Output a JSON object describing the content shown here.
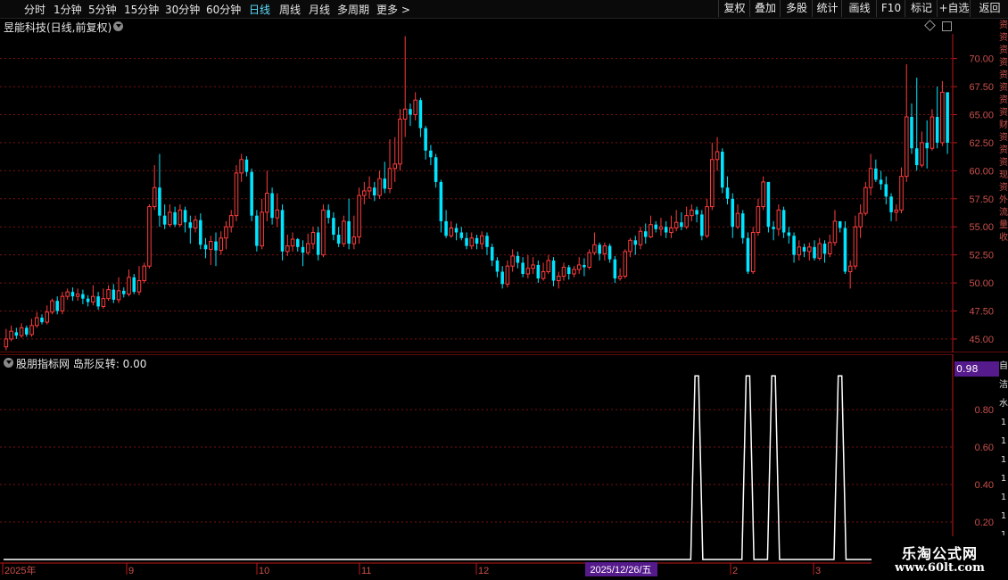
{
  "toolbar": {
    "left_items": [
      {
        "label": "分时",
        "active": false
      },
      {
        "label": "1分钟",
        "active": false
      },
      {
        "label": "5分钟",
        "active": false
      },
      {
        "label": "15分钟",
        "active": false
      },
      {
        "label": "30分钟",
        "active": false
      },
      {
        "label": "60分钟",
        "active": false
      },
      {
        "label": "日线",
        "active": true
      },
      {
        "label": "周线",
        "active": false
      },
      {
        "label": "月线",
        "active": false
      },
      {
        "label": "多周期",
        "active": false
      },
      {
        "label": "更多 >",
        "active": false
      }
    ],
    "right_items": [
      "复权",
      "叠加",
      "多股",
      "统计",
      "画线",
      "F10",
      "标记",
      "+自选",
      "返回"
    ]
  },
  "stock": {
    "title": "昱能科技(日线,前复权)"
  },
  "main_axis": {
    "ticks": [
      "70.00",
      "67.50",
      "65.00",
      "62.50",
      "60.00",
      "57.50",
      "55.00",
      "52.50",
      "50.00",
      "47.50",
      "45.00"
    ]
  },
  "indicator": {
    "title": "股朋指标网 岛形反转: 0.00",
    "badge": "0.98",
    "ticks": [
      "0.80",
      "0.60",
      "0.40",
      "0.20"
    ]
  },
  "time_axis": {
    "labels": [
      "2025年",
      "9",
      "10",
      "11",
      "12",
      "2",
      "3"
    ],
    "cursor": "2025/12/26/五"
  },
  "right_strip": {
    "top_chars": [
      "资",
      "资",
      "资",
      "资",
      "资",
      "资",
      "资",
      "资",
      "财",
      "资",
      "资",
      "资",
      "现",
      "资",
      "外",
      "流",
      "量",
      "收"
    ],
    "bottom_chars": [
      "自",
      "洁",
      "水",
      "1",
      "1",
      "1",
      "1",
      "1",
      "1",
      "1"
    ]
  },
  "watermark": {
    "line1": "乐淘公式网",
    "line2": "www.60lt.com"
  },
  "colors": {
    "up": "#ff3c3c",
    "down": "#00e5ff",
    "grid": "#7a1010",
    "axis": "#c01818",
    "signal": "#ffffff"
  },
  "chart_data": {
    "type": "candlestick",
    "ylim": [
      43.8,
      72.2
    ],
    "candles": [
      [
        44.3,
        45.0,
        44.0,
        45.9
      ],
      [
        45.0,
        45.7,
        44.8,
        46.2
      ],
      [
        45.6,
        45.3,
        45.0,
        46.0
      ],
      [
        45.3,
        46.0,
        45.1,
        46.4
      ],
      [
        46.0,
        45.4,
        45.2,
        46.2
      ],
      [
        45.4,
        46.2,
        45.2,
        46.8
      ],
      [
        46.2,
        46.9,
        46.0,
        47.4
      ],
      [
        46.9,
        46.5,
        46.3,
        47.2
      ],
      [
        46.5,
        47.4,
        46.3,
        48.0
      ],
      [
        47.4,
        48.4,
        47.2,
        48.6
      ],
      [
        48.4,
        47.5,
        47.2,
        48.8
      ],
      [
        47.5,
        48.8,
        47.2,
        49.2
      ],
      [
        48.8,
        49.2,
        48.5,
        49.5
      ],
      [
        49.2,
        48.8,
        48.4,
        49.6
      ],
      [
        48.8,
        49.0,
        48.4,
        49.5
      ],
      [
        49.0,
        48.6,
        48.1,
        49.4
      ],
      [
        48.6,
        48.3,
        47.9,
        48.9
      ],
      [
        48.3,
        48.8,
        48.0,
        49.8
      ],
      [
        48.8,
        47.9,
        47.6,
        49.2
      ],
      [
        47.9,
        48.6,
        47.7,
        49.5
      ],
      [
        48.6,
        49.4,
        48.4,
        49.8
      ],
      [
        49.4,
        48.5,
        48.2,
        49.9
      ],
      [
        48.5,
        49.3,
        48.2,
        50.5
      ],
      [
        49.3,
        49.0,
        48.7,
        49.6
      ],
      [
        49.0,
        50.5,
        48.8,
        51.2
      ],
      [
        50.5,
        49.2,
        49.0,
        50.8
      ],
      [
        49.2,
        50.2,
        48.9,
        51.5
      ],
      [
        50.2,
        51.5,
        50.0,
        51.8
      ],
      [
        51.5,
        56.8,
        51.3,
        57.0
      ],
      [
        56.8,
        58.5,
        56.5,
        60.5
      ],
      [
        58.5,
        56.0,
        55.0,
        61.5
      ],
      [
        56.0,
        55.2,
        54.8,
        57.0
      ],
      [
        55.2,
        56.3,
        55.0,
        57.0
      ],
      [
        56.3,
        55.2,
        55.0,
        56.8
      ],
      [
        55.2,
        56.5,
        55.0,
        57.0
      ],
      [
        56.5,
        55.4,
        54.5,
        56.8
      ],
      [
        55.4,
        54.9,
        53.5,
        56.0
      ],
      [
        54.9,
        55.6,
        54.5,
        56.0
      ],
      [
        55.6,
        53.4,
        53.0,
        56.2
      ],
      [
        53.4,
        53.0,
        52.2,
        54.0
      ],
      [
        53.0,
        53.7,
        51.6,
        54.2
      ],
      [
        53.7,
        52.9,
        51.5,
        54.5
      ],
      [
        52.9,
        54.0,
        52.5,
        54.6
      ],
      [
        54.0,
        55.0,
        53.0,
        55.5
      ],
      [
        55.0,
        56.0,
        54.5,
        56.5
      ],
      [
        56.0,
        59.8,
        55.5,
        60.5
      ],
      [
        59.8,
        61.0,
        59.0,
        61.5
      ],
      [
        61.0,
        59.9,
        59.5,
        61.3
      ],
      [
        59.9,
        56.0,
        55.5,
        60.2
      ],
      [
        56.0,
        53.3,
        52.8,
        56.5
      ],
      [
        53.3,
        56.3,
        53.0,
        57.5
      ],
      [
        56.3,
        58.0,
        55.5,
        60.0
      ],
      [
        58.0,
        55.8,
        55.2,
        58.5
      ],
      [
        55.8,
        56.5,
        55.0,
        58.0
      ],
      [
        56.5,
        52.8,
        52.0,
        57.0
      ],
      [
        52.8,
        53.3,
        52.4,
        54.3
      ],
      [
        53.3,
        53.9,
        52.8,
        54.5
      ],
      [
        53.9,
        53.2,
        52.8,
        54.0
      ],
      [
        53.2,
        52.7,
        51.5,
        53.8
      ],
      [
        52.7,
        53.5,
        52.5,
        54.4
      ],
      [
        53.5,
        54.5,
        53.0,
        55.0
      ],
      [
        54.5,
        52.5,
        52.0,
        55.0
      ],
      [
        52.5,
        56.5,
        52.3,
        57.0
      ],
      [
        56.5,
        55.8,
        55.3,
        57.0
      ],
      [
        55.8,
        54.3,
        53.8,
        56.3
      ],
      [
        54.3,
        53.5,
        53.2,
        55.0
      ],
      [
        53.5,
        55.5,
        53.2,
        56.0
      ],
      [
        55.5,
        53.5,
        53.0,
        57.5
      ],
      [
        53.5,
        54.1,
        53.0,
        56.0
      ],
      [
        54.1,
        57.8,
        53.5,
        58.5
      ],
      [
        57.8,
        58.2,
        57.0,
        59.0
      ],
      [
        58.2,
        58.5,
        57.5,
        59.5
      ],
      [
        58.5,
        57.8,
        57.3,
        59.0
      ],
      [
        57.8,
        59.3,
        57.5,
        60.0
      ],
      [
        59.3,
        58.4,
        58.0,
        60.8
      ],
      [
        58.4,
        60.2,
        58.0,
        62.8
      ],
      [
        60.2,
        60.6,
        59.0,
        63.0
      ],
      [
        60.6,
        64.6,
        60.0,
        65.5
      ],
      [
        64.6,
        65.5,
        63.0,
        72.0
      ],
      [
        65.5,
        65.0,
        64.0,
        66.0
      ],
      [
        65.0,
        66.3,
        64.5,
        67.0
      ],
      [
        66.3,
        63.8,
        63.0,
        66.5
      ],
      [
        63.8,
        61.8,
        61.0,
        64.0
      ],
      [
        61.8,
        61.2,
        60.5,
        62.3
      ],
      [
        61.2,
        59.0,
        58.5,
        61.5
      ],
      [
        59.0,
        55.5,
        54.5,
        59.2
      ],
      [
        55.5,
        54.2,
        54.0,
        56.5
      ],
      [
        54.2,
        54.9,
        54.0,
        55.5
      ],
      [
        54.9,
        54.5,
        53.8,
        55.3
      ],
      [
        54.5,
        54.0,
        53.8,
        55.0
      ],
      [
        54.0,
        53.3,
        53.0,
        54.5
      ],
      [
        53.3,
        54.0,
        53.0,
        54.5
      ],
      [
        54.0,
        53.5,
        53.0,
        54.3
      ],
      [
        53.5,
        54.2,
        53.0,
        54.6
      ],
      [
        54.2,
        53.2,
        52.5,
        54.5
      ],
      [
        53.2,
        52.0,
        51.5,
        53.5
      ],
      [
        52.0,
        51.0,
        50.5,
        52.3
      ],
      [
        51.0,
        49.9,
        49.5,
        51.5
      ],
      [
        49.9,
        51.5,
        49.6,
        52.0
      ],
      [
        51.5,
        52.4,
        51.0,
        53.0
      ],
      [
        52.4,
        51.8,
        51.3,
        52.8
      ],
      [
        51.8,
        50.8,
        50.5,
        52.3
      ],
      [
        50.8,
        51.3,
        50.4,
        52.5
      ],
      [
        51.3,
        51.6,
        50.8,
        52.3
      ],
      [
        51.6,
        50.4,
        50.0,
        52.0
      ],
      [
        50.4,
        51.0,
        50.2,
        51.8
      ],
      [
        51.0,
        52.0,
        50.8,
        52.5
      ],
      [
        52.0,
        50.2,
        49.7,
        52.3
      ],
      [
        50.2,
        50.6,
        49.5,
        51.0
      ],
      [
        50.6,
        51.4,
        50.2,
        51.8
      ],
      [
        51.4,
        50.8,
        50.3,
        51.6
      ],
      [
        50.8,
        51.2,
        50.5,
        51.5
      ],
      [
        51.2,
        51.6,
        50.8,
        52.3
      ],
      [
        51.6,
        51.4,
        50.6,
        52.2
      ],
      [
        51.4,
        52.7,
        51.2,
        53.0
      ],
      [
        52.7,
        53.4,
        52.5,
        54.5
      ],
      [
        53.4,
        52.6,
        52.0,
        53.6
      ],
      [
        52.6,
        53.3,
        52.0,
        53.6
      ],
      [
        53.3,
        52.1,
        51.8,
        53.5
      ],
      [
        52.1,
        50.4,
        50.0,
        52.4
      ],
      [
        50.4,
        50.6,
        50.2,
        51.3
      ],
      [
        50.6,
        52.8,
        50.4,
        53.0
      ],
      [
        52.8,
        53.8,
        52.3,
        54.0
      ],
      [
        53.8,
        53.4,
        52.5,
        54.2
      ],
      [
        53.4,
        54.6,
        53.0,
        55.0
      ],
      [
        54.6,
        54.1,
        53.5,
        55.3
      ],
      [
        54.1,
        55.2,
        54.0,
        56.0
      ],
      [
        55.2,
        54.8,
        54.5,
        55.5
      ],
      [
        54.8,
        55.0,
        54.2,
        55.8
      ],
      [
        55.0,
        54.5,
        54.0,
        55.5
      ],
      [
        54.5,
        54.9,
        54.0,
        56.0
      ],
      [
        54.9,
        55.4,
        54.6,
        56.5
      ],
      [
        55.4,
        55.0,
        54.7,
        56.3
      ],
      [
        55.0,
        56.0,
        54.8,
        56.8
      ],
      [
        56.0,
        56.5,
        55.5,
        57.0
      ],
      [
        56.5,
        56.1,
        55.4,
        56.8
      ],
      [
        56.1,
        54.2,
        53.8,
        56.5
      ],
      [
        54.2,
        56.8,
        54.0,
        57.5
      ],
      [
        56.8,
        61.0,
        56.5,
        62.5
      ],
      [
        61.0,
        61.7,
        60.0,
        63.0
      ],
      [
        61.7,
        58.5,
        58.0,
        62.0
      ],
      [
        58.5,
        57.5,
        57.0,
        59.5
      ],
      [
        57.5,
        55.0,
        54.0,
        58.0
      ],
      [
        55.0,
        56.2,
        54.8,
        57.0
      ],
      [
        56.2,
        54.0,
        53.5,
        56.5
      ],
      [
        54.0,
        51.0,
        50.8,
        54.5
      ],
      [
        51.0,
        54.5,
        50.8,
        55.0
      ],
      [
        54.5,
        56.8,
        54.2,
        57.5
      ],
      [
        56.8,
        59.0,
        56.5,
        59.5
      ],
      [
        59.0,
        55.0,
        54.5,
        59.0
      ],
      [
        55.0,
        54.8,
        53.8,
        55.5
      ],
      [
        54.8,
        56.5,
        54.2,
        57.0
      ],
      [
        56.5,
        54.5,
        54.0,
        56.8
      ],
      [
        54.5,
        54.2,
        53.5,
        55.0
      ],
      [
        54.2,
        52.5,
        51.8,
        54.5
      ],
      [
        52.5,
        53.2,
        52.0,
        53.8
      ],
      [
        53.2,
        52.8,
        52.3,
        53.5
      ],
      [
        52.8,
        53.2,
        52.0,
        53.6
      ],
      [
        53.2,
        52.2,
        52.0,
        53.8
      ],
      [
        52.2,
        53.5,
        52.0,
        54.0
      ],
      [
        53.5,
        52.6,
        51.8,
        53.8
      ],
      [
        52.6,
        53.6,
        52.3,
        54.3
      ],
      [
        53.6,
        55.5,
        53.3,
        56.5
      ],
      [
        55.5,
        54.9,
        54.5,
        55.5
      ],
      [
        54.9,
        51.0,
        50.8,
        55.5
      ],
      [
        51.0,
        51.5,
        49.5,
        52.0
      ],
      [
        51.5,
        55.0,
        51.2,
        56.0
      ],
      [
        55.0,
        56.2,
        54.0,
        57.0
      ],
      [
        56.2,
        58.5,
        56.0,
        59.0
      ],
      [
        58.5,
        60.2,
        57.8,
        61.5
      ],
      [
        60.2,
        59.2,
        59.0,
        61.0
      ],
      [
        59.2,
        58.8,
        58.3,
        60.0
      ],
      [
        58.8,
        57.7,
        57.0,
        59.5
      ],
      [
        57.7,
        56.3,
        55.5,
        58.0
      ],
      [
        56.3,
        56.5,
        55.5,
        57.0
      ],
      [
        56.5,
        59.5,
        56.2,
        60.3
      ],
      [
        59.5,
        64.8,
        59.0,
        69.5
      ],
      [
        64.8,
        62.0,
        61.5,
        66.0
      ],
      [
        62.0,
        60.5,
        60.0,
        68.3
      ],
      [
        60.5,
        62.5,
        60.3,
        63.5
      ],
      [
        62.5,
        62.0,
        60.2,
        64.5
      ],
      [
        62.0,
        64.8,
        61.8,
        65.5
      ],
      [
        64.8,
        62.5,
        62.0,
        67.5
      ],
      [
        62.5,
        67.0,
        62.2,
        68.0
      ],
      [
        67.0,
        62.5,
        61.5,
        66.5
      ]
    ],
    "signal": {
      "peak_at_index": [
        135,
        145,
        150,
        163
      ],
      "peak_value": 0.98
    }
  }
}
